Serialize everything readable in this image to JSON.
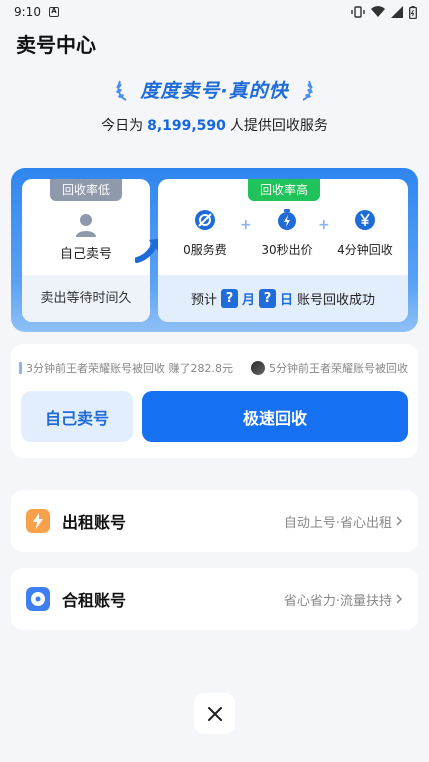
{
  "status_bar": {
    "time": "9:10",
    "notif_letter": "A"
  },
  "header": {
    "title": "卖号中心"
  },
  "hero": {
    "slogan": "度度卖号·真的快",
    "sub_prefix": "今日为",
    "count": "8,199,590",
    "sub_suffix": "人提供回收服务"
  },
  "compare": {
    "low": {
      "tag": "回收率低",
      "label": "自己卖号",
      "foot": "卖出等待时间久"
    },
    "high": {
      "tag": "回收率高",
      "features": [
        {
          "icon": "no-fee-icon",
          "label": "0服务费"
        },
        {
          "icon": "stopwatch-icon",
          "label": "30秒出价"
        },
        {
          "icon": "yen-icon",
          "label": "4分钟回收"
        }
      ],
      "plus": "+",
      "foot_prefix": "预计",
      "q": "?",
      "month": "月",
      "day": "日",
      "foot_suffix": "账号回收成功"
    },
    "colors": {
      "accent": "#1f6bd8",
      "green_tag": "#20c25a",
      "gray_tag": "#8e9aab"
    }
  },
  "ticker": {
    "items": [
      {
        "text": "3分钟前王者荣耀账号被回收 赚了282.8元"
      },
      {
        "text": "5分钟前王者荣耀账号被回收"
      }
    ]
  },
  "actions": {
    "self_sell": "自己卖号",
    "fast_recycle": "极速回收"
  },
  "rows": [
    {
      "title": "出租账号",
      "hint": "自动上号·省心出租",
      "icon": "lightning-icon",
      "color": "#f7a24a"
    },
    {
      "title": "合租账号",
      "hint": "省心省力·流量扶持",
      "icon": "disc-icon",
      "color": "#3d7ef0"
    }
  ]
}
